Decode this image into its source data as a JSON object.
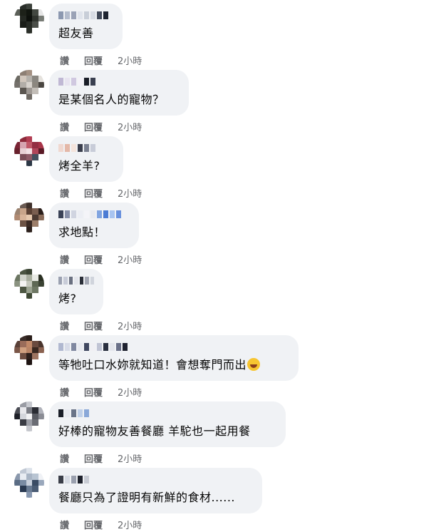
{
  "actions": {
    "like": "讚",
    "reply": "回覆",
    "time": "2小時"
  },
  "comments": [
    {
      "text": "超友善",
      "avatar_colors": [
        "#fff",
        "#2a2e2a",
        "#3b403a",
        "#fff",
        "#fff",
        "#5b5f58",
        "#1d2119",
        "#11150f",
        "#434841",
        "#e6e6e6",
        "#fff",
        "#242822",
        "#0d100c",
        "#30342e",
        "#777b75",
        "#fff",
        "#1a1d18",
        "#262a24",
        "#4b4f49",
        "#fff",
        "#fff",
        "#fff",
        "#2b2f29",
        "#fff",
        "#fff"
      ],
      "name_colors": [
        "#8c98b0",
        "#b4bccc",
        "#9aa2b6",
        "#e0e4ec",
        "#c8ced8",
        "#d8dce4",
        "#404858",
        "#1e2430"
      ]
    },
    {
      "text": "是某個名人的寵物？",
      "avatar_colors": [
        "#fff",
        "#8d7f74",
        "#a49183",
        "#fff",
        "#fff",
        "#6c6a63",
        "#d2c7bd",
        "#b5b1ab",
        "#8a8781",
        "#e5e2dd",
        "#74706b",
        "#b3aea8",
        "#d8d3cd",
        "#8c877f",
        "#4a4641",
        "#fff",
        "#5b5650",
        "#9f9994",
        "#c3beb8",
        "#fff",
        "#fff",
        "#fff",
        "#6f6a64",
        "#fff",
        "#fff"
      ],
      "name_colors": [
        "#c0b8d4",
        "#e8e4f0",
        "#d0c8e0",
        "#f4f2f8",
        "#1a1e28",
        "#3a4050"
      ]
    },
    {
      "text": "烤全羊?",
      "avatar_colors": [
        "#fff",
        "#8c2a3a",
        "#b23d52",
        "#fff",
        "#fff",
        "#7a2435",
        "#d6a4b0",
        "#c05868",
        "#932e42",
        "#a83448",
        "#68202c",
        "#e8d0d4",
        "#f2e0e4",
        "#b0465a",
        "#5a1a26",
        "#fff",
        "#7a4c56",
        "#8e5a66",
        "#44505e",
        "#fff",
        "#fff",
        "#fff",
        "#2c3846",
        "#fff",
        "#fff"
      ],
      "name_colors": [
        "#f0d8d0",
        "#e4b8a8",
        "#f4e4dc",
        "#3a3e4c",
        "#7a8090",
        "#c8ccd8"
      ]
    },
    {
      "text": "求地點！",
      "avatar_colors": [
        "#fff",
        "#6a5a52",
        "#3e302a",
        "#fff",
        "#fff",
        "#9a8270",
        "#c8a48a",
        "#5a4034",
        "#7a5e50",
        "#2a1e1a",
        "#b08a72",
        "#d8b49a",
        "#e6c8ae",
        "#4c3a32",
        "#8a6c5a",
        "#fff",
        "#6c5244",
        "#3a2a24",
        "#9c7e6a",
        "#fff",
        "#fff",
        "#fff",
        "#2c201c",
        "#fff",
        "#fff"
      ],
      "name_colors": [
        "#3a4256",
        "#8890a8",
        "#d0d4e0",
        "#eceef4",
        "#f4f4f8",
        "#e8eaf0",
        "#80a4e0",
        "#4c7cd4",
        "#a8c4f0",
        "#6890dc"
      ]
    },
    {
      "text": "烤?",
      "avatar_colors": [
        "#fff",
        "#4a5440",
        "#3a4432",
        "#fff",
        "#fff",
        "#6c7662",
        "#d0d4ca",
        "#a8ae9e",
        "#e8eae4",
        "#2a3022",
        "#8a9280",
        "#f4f4f2",
        "#c4c8bc",
        "#5e6854",
        "#3a4232",
        "#fff",
        "#4c5642",
        "#9ca492",
        "#6e7864",
        "#fff",
        "#fff",
        "#fff",
        "#3e4834",
        "#fff",
        "#fff"
      ],
      "name_colors": [
        "#9aa0b0",
        "#c8ccd8",
        "#6a7080",
        "#e4e6ec",
        "#2a2e38",
        "#a4a8b4",
        "#d0d4dc"
      ]
    },
    {
      "text": "等牠吐口水妳就知道！會想奪門而出",
      "avatar_colors": [
        "#fff",
        "#3a2c28",
        "#2a1e1a",
        "#fff",
        "#fff",
        "#5a4038",
        "#9a6c5a",
        "#c08868",
        "#6a4a3e",
        "#4a342c",
        "#7a5648",
        "#d0a080",
        "#b88466",
        "#3a2820",
        "#8a6250",
        "#fff",
        "#6c4c40",
        "#2c1e1a",
        "#9e7460",
        "#fff",
        "#fff",
        "#fff",
        "#1e1412",
        "#fff",
        "#fff"
      ],
      "name_colors": [
        "#b0b8d0",
        "#d8dce8",
        "#8088a0",
        "#e8eaf0",
        "#404860",
        "#f0f0f4",
        "#c0c4d4",
        "#2a3040",
        "#e4e6ec",
        "#6a7088",
        "#1e2230"
      ]
    },
    {
      "text": "好棒的寵物友善餐廳 羊駝也一起用餐",
      "avatar_colors": [
        "#fff",
        "#9a9ca4",
        "#c8cad0",
        "#fff",
        "#fff",
        "#4a4c54",
        "#e8e8ec",
        "#7a7c84",
        "#2a2c34",
        "#b0b2ba",
        "#1e2028",
        "#d4d6dc",
        "#f2f2f4",
        "#5a5c64",
        "#8a8c94",
        "#fff",
        "#3a3c44",
        "#9c9ea6",
        "#6a6c74",
        "#fff",
        "#fff",
        "#fff",
        "#c4c6cc",
        "#fff",
        "#fff"
      ],
      "name_colors": [
        "#1a1e28",
        "#e8eaf0",
        "#6a7488",
        "#c0d0e8",
        "#8aa8d8"
      ]
    },
    {
      "text": "餐廳只為了證明有新鮮的食材......",
      "avatar_colors": [
        "#fff",
        "#c0c8d4",
        "#dce2ea",
        "#fff",
        "#fff",
        "#8a98ac",
        "#e8ecf2",
        "#a8b4c4",
        "#b8c4d2",
        "#f0f2f6",
        "#5a6c84",
        "#7a8ca4",
        "#c8d0dc",
        "#3a4c64",
        "#9aa8bc",
        "#fff",
        "#2a3a52",
        "#6a7c94",
        "#4a5c74",
        "#fff",
        "#fff",
        "#fff",
        "#8898b0",
        "#fff",
        "#fff"
      ],
      "name_colors": [
        "#3a3e48",
        "#d8dce4",
        "#9aa0ae",
        "#1e222c",
        "#c8ccd4"
      ]
    }
  ]
}
